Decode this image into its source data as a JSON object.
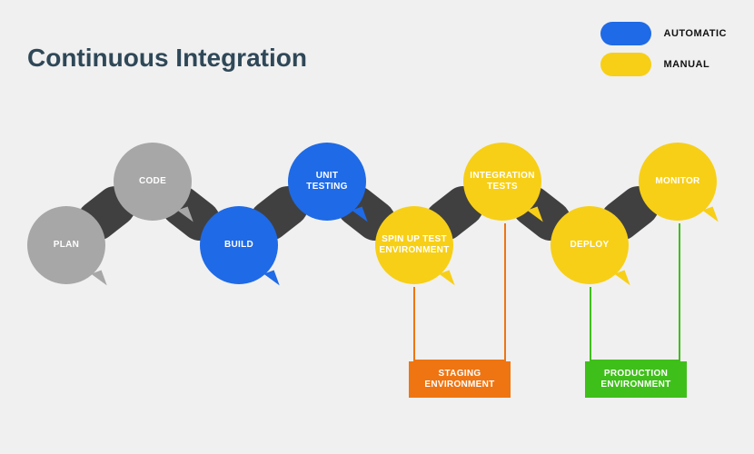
{
  "title": "Continuous Integration",
  "legend": {
    "automatic": {
      "label": "AUTOMATIC",
      "color": "#1f6ae6"
    },
    "manual": {
      "label": "MANUAL",
      "color": "#f7cf17"
    }
  },
  "colors": {
    "gray": "#a7a7a7",
    "blue": "#1f6ae6",
    "yellow": "#f7cf17",
    "dark": "#404040",
    "orange": "#ee7512",
    "green": "#3fbf1a"
  },
  "nodes": [
    {
      "id": "plan",
      "label": "PLAN",
      "color": "gray"
    },
    {
      "id": "code",
      "label": "CODE",
      "color": "gray"
    },
    {
      "id": "build",
      "label": "BUILD",
      "color": "blue"
    },
    {
      "id": "unit-testing",
      "label": "UNIT\nTESTING",
      "color": "blue"
    },
    {
      "id": "spin-up",
      "label": "SPIN UP TEST\nENVIRONMENT",
      "color": "yellow"
    },
    {
      "id": "integration-tests",
      "label": "INTEGRATION\nTESTS",
      "color": "yellow"
    },
    {
      "id": "deploy",
      "label": "DEPLOY",
      "color": "yellow"
    },
    {
      "id": "monitor",
      "label": "MONITOR",
      "color": "yellow"
    }
  ],
  "environments": {
    "staging": {
      "label": "STAGING\nENVIRONMENT",
      "color": "orange"
    },
    "production": {
      "label": "PRODUCTION\nENVIRONMENT",
      "color": "green"
    }
  }
}
